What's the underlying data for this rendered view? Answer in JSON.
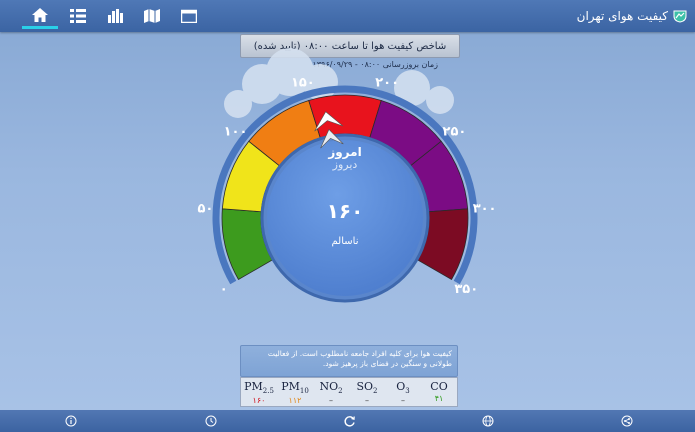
{
  "app": {
    "title": "کیفیت هوای تهران"
  },
  "nav": [
    {
      "icon": "home-icon",
      "active": true
    },
    {
      "icon": "list-icon",
      "active": false
    },
    {
      "icon": "bar-chart-icon",
      "active": false
    },
    {
      "icon": "map-icon",
      "active": false
    },
    {
      "icon": "calendar-icon",
      "active": false
    }
  ],
  "header": {
    "title": "شاخص کیفیت هوا تا ساعت ۰۸:۰۰ (تایید شده)",
    "updated": "زمان بروزرسانی      ۰۸:۰۰ - ۱۳۹۶/۰۹/۲۹"
  },
  "gauge": {
    "ticks": [
      "۰",
      "۵۰",
      "۱۰۰",
      "۱۵۰",
      "۲۰۰",
      "۲۵۰",
      "۳۰۰",
      "۳۵۰"
    ],
    "labels": {
      "today": "امروز",
      "yesterday": "دیروز"
    },
    "value": "۱۶۰",
    "status": "ناسالم",
    "aqi": 160,
    "colors": [
      "#3d9b1e",
      "#f0e41a",
      "#f07e13",
      "#e8131d",
      "#7b0c84",
      "#7b0c84",
      "#7c0b23"
    ]
  },
  "advice": "کیفیت هوا برای کلیه افراد جامعه نامطلوب است. از فعالیت طولانی و سنگین در فضای باز پرهیز شود.",
  "pollutants": [
    {
      "name": "PM",
      "sub": "2.5",
      "value": "۱۶۰",
      "color": "#d0121c"
    },
    {
      "name": "PM",
      "sub": "10",
      "value": "۱۱۲",
      "color": "#e08a1c"
    },
    {
      "name": "NO",
      "sub": "2",
      "value": "–",
      "color": "#333333"
    },
    {
      "name": "SO",
      "sub": "2",
      "value": "–",
      "color": "#333333"
    },
    {
      "name": "O",
      "sub": "3",
      "value": "–",
      "color": "#333333"
    },
    {
      "name": "CO",
      "sub": "",
      "value": "۴۱",
      "color": "#2f9a1a"
    }
  ],
  "bottom": [
    {
      "icon": "info-icon"
    },
    {
      "icon": "history-icon"
    },
    {
      "icon": "refresh-icon"
    },
    {
      "icon": "globe-icon"
    },
    {
      "icon": "share-icon"
    }
  ]
}
